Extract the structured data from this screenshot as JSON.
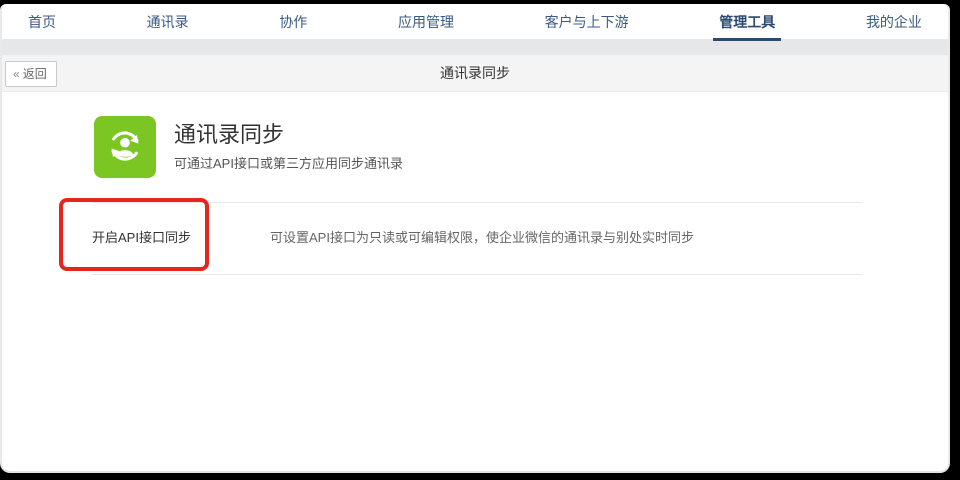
{
  "nav": {
    "items": [
      "首页",
      "通讯录",
      "协作",
      "应用管理",
      "客户与上下游",
      "管理工具",
      "我的企业"
    ],
    "active_label": "管理工具"
  },
  "toolbar": {
    "back_icon": "«",
    "back_label": "返回",
    "title": "通讯录同步"
  },
  "feature": {
    "title": "通讯录同步",
    "subtitle": "可通过API接口或第三方应用同步通讯录",
    "icon": "contact-sync-icon"
  },
  "api_sync_row": {
    "label": "开启API接口同步",
    "description": "可设置API接口为只读或可编辑权限，使企业微信的通讯录与别处实时同步"
  },
  "colors": {
    "icon_green": "#7cc624",
    "nav_text_blue": "#3a5a85",
    "active_tab_navy": "#2b4a6f",
    "annotation_red": "#e8251d",
    "toolbar_gray": "#f4f4f5"
  }
}
